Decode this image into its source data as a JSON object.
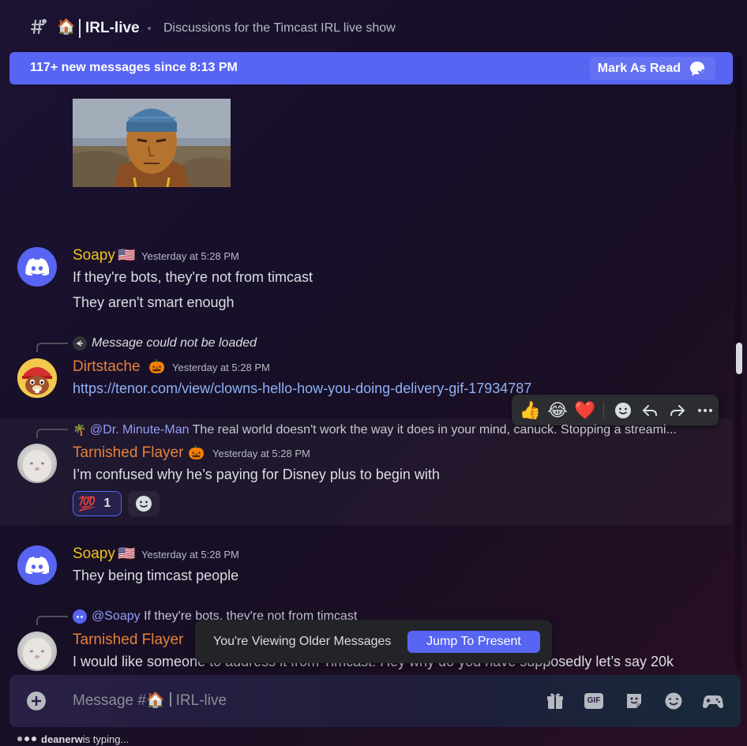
{
  "header": {
    "channel_emoji": "🏠",
    "channel_name": "IRL-live",
    "topic": "Discussions for the Timcast IRL live show"
  },
  "new_messages_bar": {
    "text": "117+ new messages since 8:13 PM",
    "mark_as_read": "Mark As Read"
  },
  "messages": [
    {
      "username": "Soapy",
      "flag": "🇺🇸",
      "timestamp": "Yesterday at 5:28 PM",
      "lines": [
        "If they're bots, they're not from timcast",
        "They aren't smart enough"
      ]
    },
    {
      "reply": "Message could not be loaded",
      "username": "Dirtstache",
      "badge": "🎃",
      "timestamp": "Yesterday at 5:28 PM",
      "link": "https://tenor.com/view/clowns-hello-how-you-doing-delivery-gif-17934787"
    },
    {
      "reply_icon": "🌴",
      "reply_mention": "@Dr. Minute-Man",
      "reply_text": "The real world doesn't work the way it does in your mind, canuck. Stopping a streami...",
      "username": "Tarnished Flayer",
      "badge": "🎃",
      "timestamp": "Yesterday at 5:28 PM",
      "text": "I’m confused why he’s paying for Disney plus to begin with",
      "reaction_emoji": "💯",
      "reaction_count": "1"
    },
    {
      "username": "Soapy",
      "flag": "🇺🇸",
      "timestamp": "Yesterday at 5:28 PM",
      "text": "They being timcast people"
    },
    {
      "reply_mention": "@Soapy",
      "reply_text": "If they're bots, they're not from timcast",
      "username": "Tarnished Flayer",
      "text": "I would like someone to address it from Timcast. Hey why do you have supposedly let’s say 20k"
    }
  ],
  "hover_toolbar": {
    "quick_reactions": [
      "👍",
      "😂",
      "❤️"
    ]
  },
  "older_messages_bar": {
    "text": "You're Viewing Older Messages",
    "button": "Jump To Present"
  },
  "composer": {
    "placeholder_prefix": "Message #",
    "placeholder_emoji": "🏠",
    "placeholder_channel": "IRL-live",
    "gif_label": "GIF"
  },
  "typing": {
    "user": "deanerw",
    "text": " is typing..."
  },
  "colors": {
    "accent": "#5865f2",
    "username_yellow": "#f2c21a",
    "username_orange": "#e6803a",
    "link": "#8fb1f5"
  }
}
